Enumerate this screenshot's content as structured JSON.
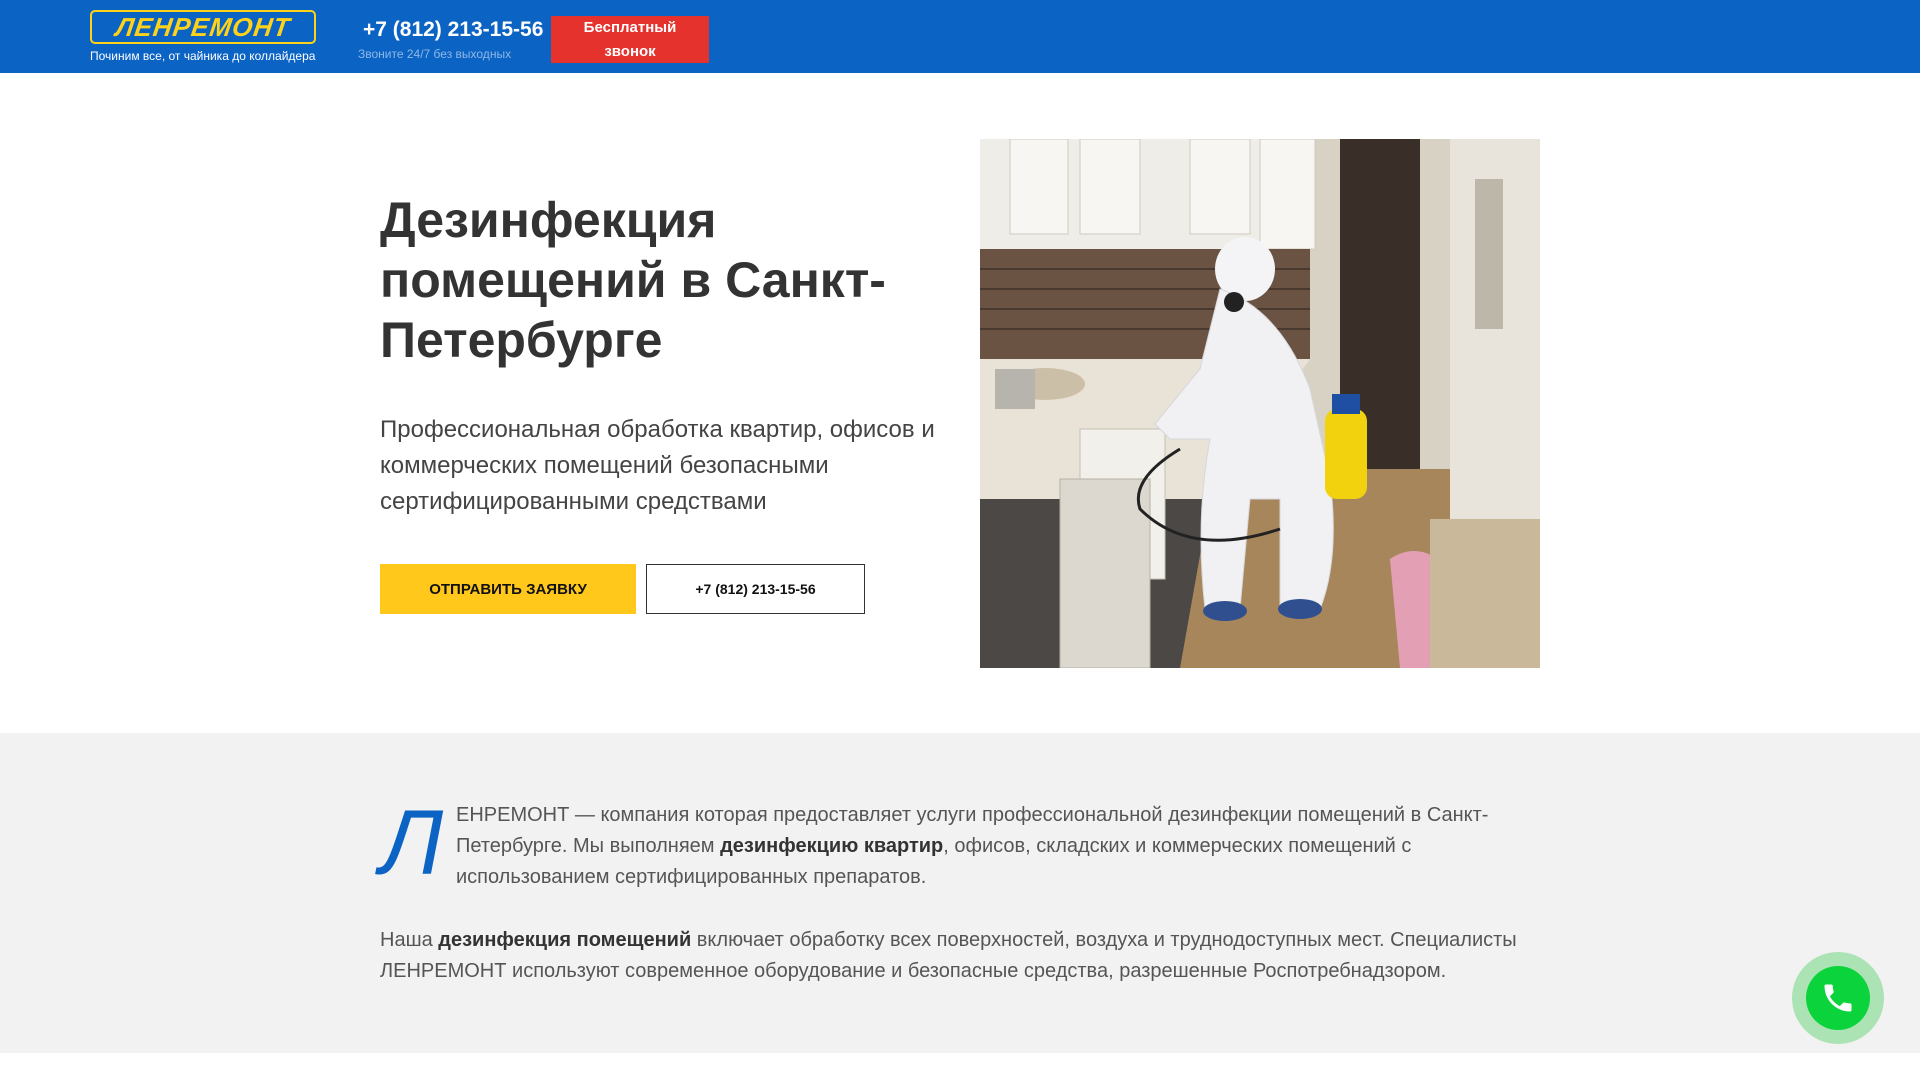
{
  "header": {
    "logo": "ЛЕНРЕМОНТ",
    "tagline": "Починим все, от чайника до коллайдера",
    "phone": "+7 (812) 213-15-56",
    "phone_note": "Звоните 24/7 без выходных",
    "callback_label": "Бесплатный звонок",
    "colors": {
      "bar": "#0b63c4",
      "logo": "#ffd21a",
      "callback": "#e5322d"
    }
  },
  "hero": {
    "title": "Дезинфекция помещений в Санкт-Петербурге",
    "subtitle": "Профессиональная обработка квартир, офисов и коммерческих помещений безопасными сертифицированными средствами",
    "request_button": "ОТПРАВИТЬ ЗАЯВКУ",
    "phone_button": "+7 (812) 213-15-56",
    "photo_icon": "disinfection-worker-photo"
  },
  "info": {
    "dropcap": "Л",
    "para1": {
      "before": "ЕНРЕМОНТ — компания которая предоставляет услуги профессиональной дезинфекции помещений в Санкт-Петербурге. Мы выполняем ",
      "bold": "дезинфекцию квартир",
      "after": ", офисов, складских и коммерческих помещений с использованием сертифицированных препаратов."
    },
    "para2": {
      "before": "Наша ",
      "bold": "дезинфекция помещений",
      "after": " включает обработку всех поверхностей, воздуха и труднодоступных мест. Специалисты ЛЕНРЕМОНТ используют современное оборудование и безопасные средства, разрешенные Роспотребнадзором."
    }
  },
  "floating": {
    "icon": "phone-icon",
    "color": "#0bd33c"
  }
}
